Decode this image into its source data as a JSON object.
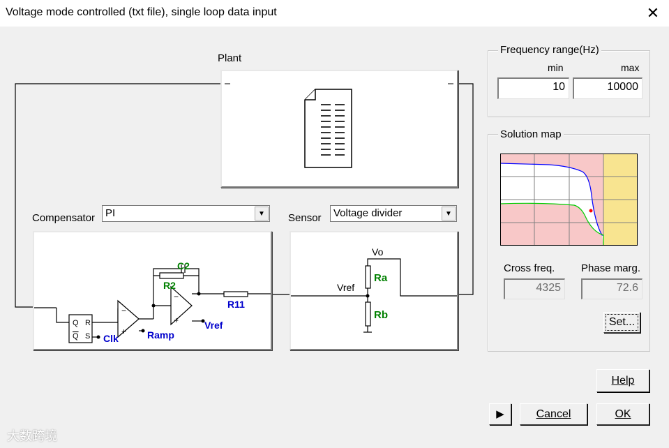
{
  "window": {
    "title": "Voltage mode controlled (txt file), single loop data input"
  },
  "plant": {
    "label": "Plant"
  },
  "compensator": {
    "label": "Compensator",
    "selected": "PI"
  },
  "sensor": {
    "label": "Sensor",
    "selected": "Voltage divider"
  },
  "circuit": {
    "comp_labels": {
      "c2": "C2",
      "r2": "R2",
      "r11": "R11",
      "clk": "Clk",
      "ramp": "Ramp",
      "vref": "Vref",
      "q": "Q",
      "qbar": "Q",
      "r": "R",
      "s": "S",
      "minus": "−",
      "plus": "+"
    },
    "sensor_labels": {
      "vo": "Vo",
      "vref": "Vref",
      "ra": "Ra",
      "rb": "Rb"
    },
    "colors": {
      "green": "#008000",
      "blue": "#0000cc"
    }
  },
  "frequency_range": {
    "label": "Frequency range(Hz)",
    "min_label": "min",
    "max_label": "max",
    "min": "10",
    "max": "10000"
  },
  "solution_map": {
    "label": "Solution map",
    "colors": {
      "pink": "#f8c8c8",
      "yellow": "#f8e490",
      "upper_curve": "#0000ff",
      "lower_curve": "#00cc00",
      "point": "#ff0000"
    }
  },
  "results": {
    "cross_freq_label": "Cross freq.",
    "cross_freq": "4325",
    "phase_marg_label": "Phase marg.",
    "phase_marg": "72.6"
  },
  "buttons": {
    "set": "Set...",
    "help": "Help",
    "cancel": "Cancel",
    "ok": "OK",
    "play": "▶"
  },
  "watermark": "大数跨境"
}
